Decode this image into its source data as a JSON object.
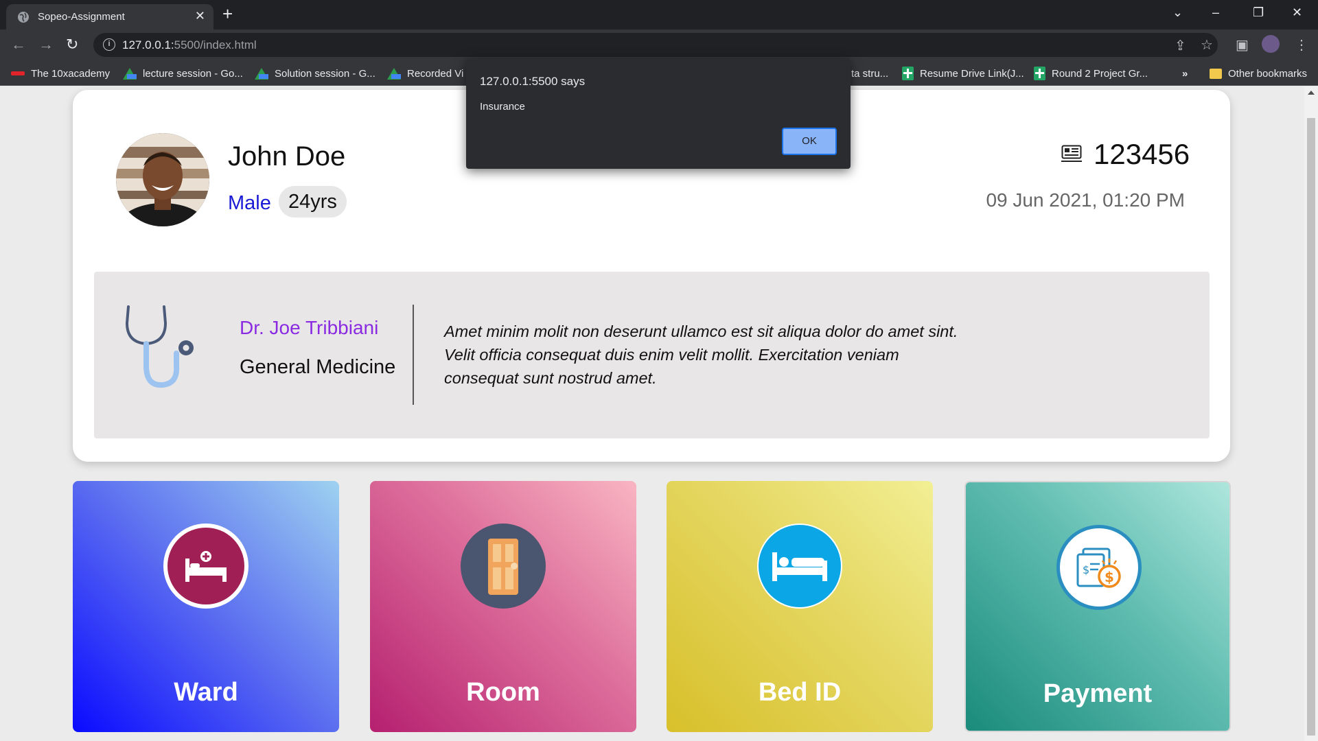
{
  "browser": {
    "tab_title": "Sopeo-Assignment",
    "url_host": "127.0.0.1:",
    "url_path": "5500/index.html",
    "bookmarks": [
      {
        "label": "The 10xacademy",
        "icon": "10x-logo-icon"
      },
      {
        "label": "lecture session - Go...",
        "icon": "google-drive-icon"
      },
      {
        "label": "Solution session - G...",
        "icon": "google-drive-icon"
      },
      {
        "label": "Recorded Vi",
        "icon": "google-drive-icon"
      },
      {
        "label": "ta stru...",
        "icon": ""
      },
      {
        "label": "Resume Drive Link(J...",
        "icon": "google-sheets-icon"
      },
      {
        "label": "Round 2 Project Gr...",
        "icon": "google-sheets-icon"
      }
    ],
    "overflow_label": "»",
    "other_bookmarks": "Other bookmarks"
  },
  "patient": {
    "name": "John Doe",
    "gender": "Male",
    "age": "24yrs",
    "id": "123456",
    "timestamp": "09 Jun 2021, 01:20 PM"
  },
  "doctor": {
    "name": "Dr. Joe Tribbiani",
    "department": "General Medicine",
    "description": "Amet minim molit non deserunt ullamco est sit aliqua dolor do amet sint. Velit officia consequat duis enim velit mollit. Exercitation veniam consequat sunt nostrud amet."
  },
  "tiles": [
    {
      "label": "Ward",
      "icon": "hospital-bed-icon"
    },
    {
      "label": "Room",
      "icon": "door-icon"
    },
    {
      "label": "Bed ID",
      "icon": "bed-icon"
    },
    {
      "label": "Payment",
      "icon": "payment-icon"
    }
  ],
  "dialog": {
    "title": "127.0.0.1:5500 says",
    "message": "Insurance",
    "ok_label": "OK"
  },
  "colors": {
    "gender": "#1a1ad6",
    "doctor_name": "#8a2be2",
    "dialog_button": "#8ab4f8"
  }
}
